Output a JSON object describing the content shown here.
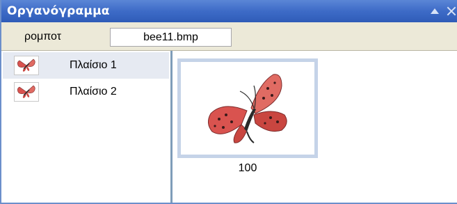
{
  "titlebar": {
    "title": "Οργανόγραμμα",
    "collapse_icon": "chevron-up-icon",
    "close_icon": "close-icon"
  },
  "toolbar": {
    "robot_label": "ρομποτ",
    "file_value": "bee11.bmp"
  },
  "frames": [
    {
      "label": "Πλαίσιο 1",
      "icon": "butterfly-thumbnail-icon",
      "selected": true
    },
    {
      "label": "Πλαίσιο 2",
      "icon": "butterfly-thumbnail-icon",
      "selected": false
    }
  ],
  "preview": {
    "icon": "butterfly-image",
    "caption": "100"
  },
  "colors": {
    "titlebar": "#3d6bc7",
    "toolbar": "#ece9d8",
    "selection": "#e6eaf2",
    "card_border": "#c5d3e8",
    "butterfly_wing": "#d9534f"
  }
}
